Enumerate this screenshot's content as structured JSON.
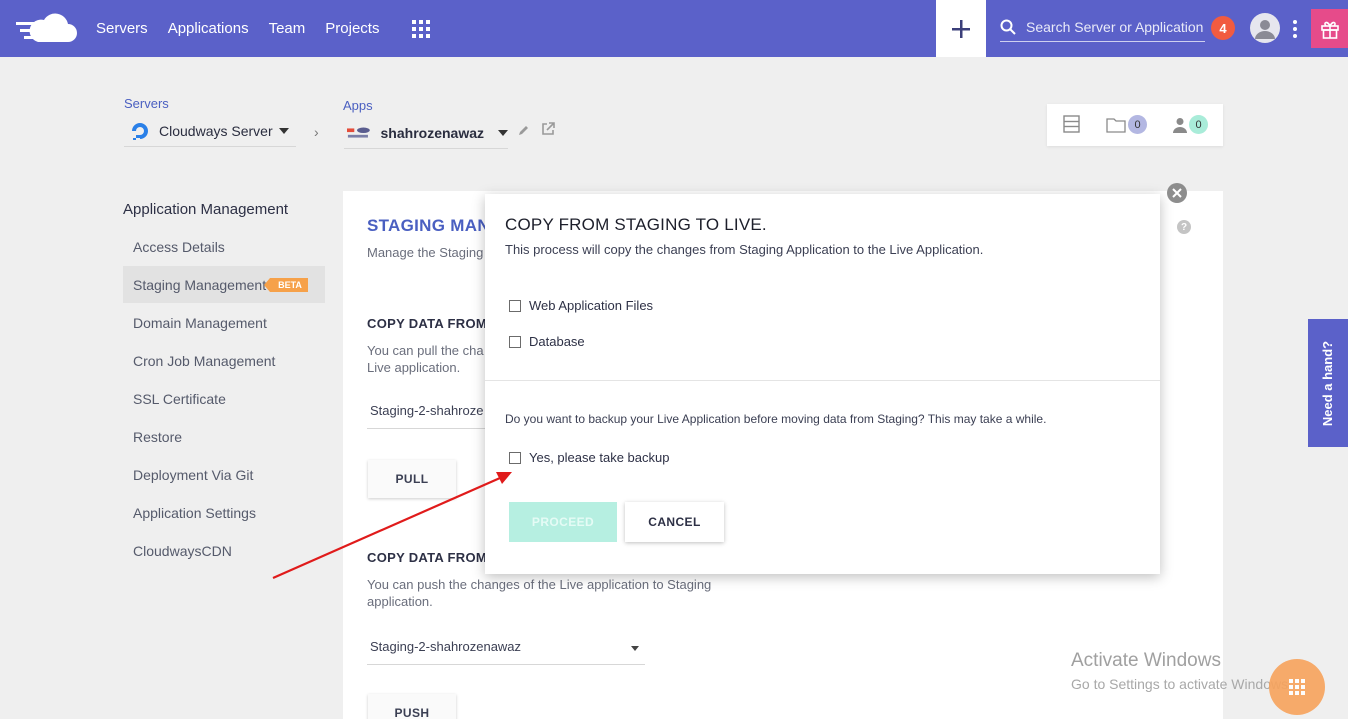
{
  "topbar": {
    "nav": [
      "Servers",
      "Applications",
      "Team",
      "Projects"
    ],
    "search_placeholder": "Search Server or Application",
    "notification_count": "4",
    "accent": "#5b61c9"
  },
  "breadcrumb": {
    "servers_label": "Servers",
    "server_name": "Cloudways Server",
    "apps_label": "Apps",
    "app_name": "shahrozenawaz"
  },
  "stats": {
    "folder_count": "0",
    "user_count": "0"
  },
  "sidebar": {
    "title": "Application Management",
    "items": [
      {
        "label": "Access Details"
      },
      {
        "label": "Staging Management",
        "badge": "BETA"
      },
      {
        "label": "Domain Management"
      },
      {
        "label": "Cron Job Management"
      },
      {
        "label": "SSL Certificate"
      },
      {
        "label": "Restore"
      },
      {
        "label": "Deployment Via Git"
      },
      {
        "label": "Application Settings"
      },
      {
        "label": "CloudwaysCDN"
      }
    ]
  },
  "panel": {
    "title": "STAGING MAN",
    "subtitle": "Manage the Staging",
    "pull_title": "COPY DATA FROM",
    "pull_desc": "You can pull the cha Live application.",
    "pull_select": "Staging-2-shahroze",
    "pull_button": "PULL",
    "push_title": "COPY DATA FROM",
    "push_desc": "You can push the changes of the Live application to Staging application.",
    "push_select": "Staging-2-shahrozenawaz",
    "push_button": "PUSH",
    "help": "?"
  },
  "modal": {
    "title": "COPY FROM STAGING TO LIVE.",
    "description": "This process will copy the changes from Staging Application to the Live Application.",
    "options": [
      {
        "label": "Web Application Files",
        "checked": false
      },
      {
        "label": "Database",
        "checked": false
      }
    ],
    "backup_question": "Do you want to backup your Live Application before moving data from Staging? This may take a while.",
    "backup_option": "Yes, please take backup",
    "proceed_label": "PROCEED",
    "cancel_label": "CANCEL"
  },
  "help_tab": "Need a hand?",
  "watermark": {
    "line1": "Activate Windows",
    "line2": "Go to Settings to activate Windows."
  }
}
